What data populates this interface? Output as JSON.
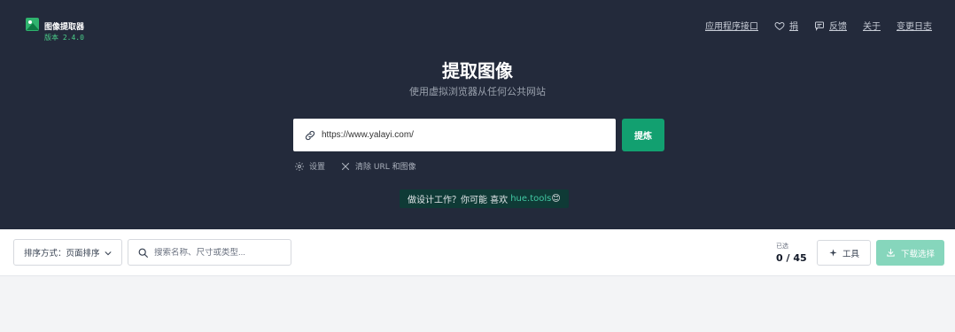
{
  "brand": {
    "title": "图像提取器",
    "version": "版本 2.4.0",
    "logo_icon": "image-icon"
  },
  "nav": [
    {
      "label": "应用程序接口",
      "icon": ""
    },
    {
      "label": "捐",
      "icon": "heart-icon"
    },
    {
      "label": "反馈",
      "icon": "chat-icon"
    },
    {
      "label": "关于",
      "icon": ""
    },
    {
      "label": "变更日志",
      "icon": ""
    }
  ],
  "hero": {
    "title": "提取图像",
    "subtitle": "使用虚拟浏览器从任何公共网站"
  },
  "url_input": {
    "value": "https://www.yalayi.com/",
    "placeholder": ""
  },
  "extract_button": "提炼",
  "options": {
    "settings": "设置",
    "clear": "清除 URL 和图像"
  },
  "promo": {
    "text": "做设计工作？你可能 喜欢",
    "link": "hue.tools",
    "emoji": "😊"
  },
  "toolbar": {
    "sort_label": "排序方式：页面排序",
    "search_placeholder": "搜索名称、尺寸或类型...",
    "selected_label": "已选",
    "selected_count": "0 / 45",
    "tools_label": "工具",
    "download_label": "下载选择"
  },
  "colors": {
    "hero_bg": "#232a3b",
    "accent": "#12a070",
    "download_disabled": "#86d6bc"
  }
}
